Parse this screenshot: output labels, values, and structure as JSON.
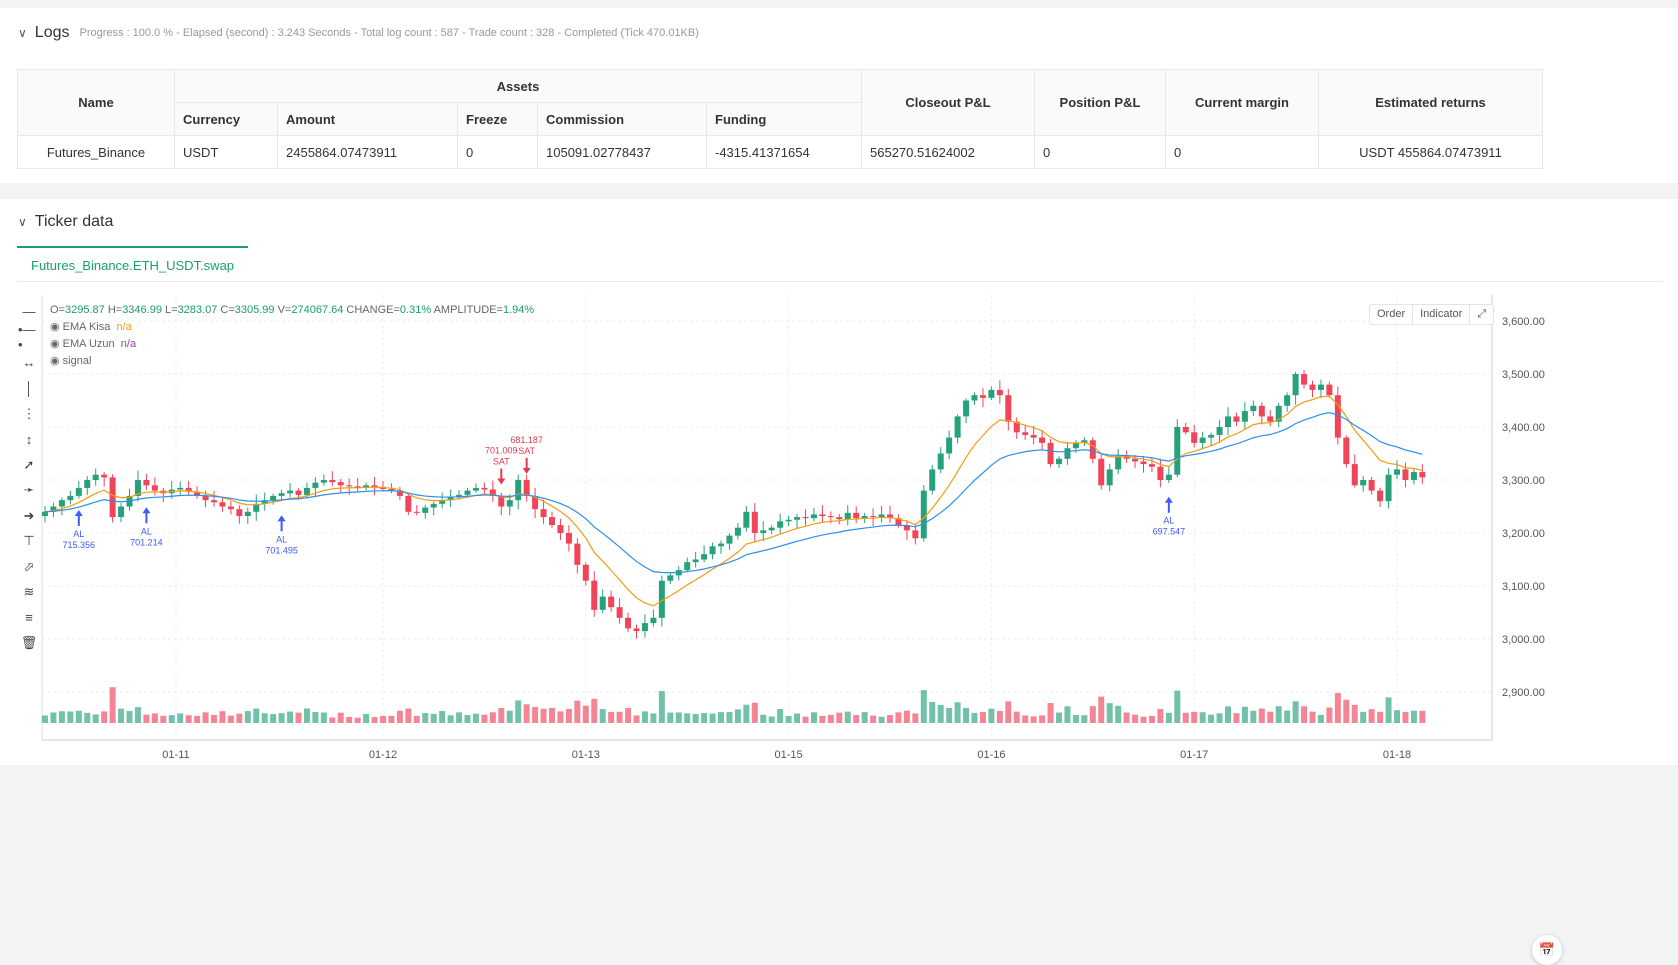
{
  "logs": {
    "title": "Logs",
    "status": "Progress : 100.0 % - Elapsed (second) :  3.243  Seconds - Total log count : 587 - Trade count : 328 - Completed (Tick 470.01KB)",
    "table": {
      "name_header": "Name",
      "assets_header": "Assets",
      "sub_headers": [
        "Currency",
        "Amount",
        "Freeze",
        "Commission",
        "Funding"
      ],
      "other_headers": [
        "Closeout P&L",
        "Position P&L",
        "Current margin",
        "Estimated returns"
      ],
      "row": {
        "name": "Futures_Binance",
        "currency": "USDT",
        "amount": "2455864.07473911",
        "freeze": "0",
        "commission": "105091.02778437",
        "funding": "-4315.41371654",
        "closeout": "565270.51624002",
        "position": "0",
        "margin": "0",
        "returns": "USDT 455864.07473911"
      }
    }
  },
  "ticker": {
    "title": "Ticker data",
    "tab": "Futures_Binance.ETH_USDT.swap",
    "ohlc": {
      "o_label": "O=",
      "o": "3295.87",
      "h_label": "H=",
      "h": "3346.99",
      "l_label": "L=",
      "l": "3283.07",
      "c_label": "C=",
      "c": "3305.99",
      "v_label": "V=",
      "v": "274067.64",
      "chg_label": "CHANGE=",
      "chg": "0.31%",
      "amp_label": "AMPLITUDE=",
      "amp": "1.94%"
    },
    "indicators": [
      {
        "name": "EMA Kisa",
        "value": "n/a",
        "color": "#f39c12"
      },
      {
        "name": "EMA Uzun",
        "value": "n/a",
        "color": "#8e44ad"
      },
      {
        "name": "signal",
        "value": ""
      }
    ],
    "buttons": {
      "order": "Order",
      "indicator": "Indicator"
    }
  },
  "chart_data": {
    "type": "candlestick",
    "y_ticks": [
      "3,600.00",
      "3,500.00",
      "3,400.00",
      "3,300.00",
      "3,200.00",
      "3,100.00",
      "3,000.00",
      "2,900.00"
    ],
    "ylim": [
      2850,
      3650
    ],
    "x_ticks": [
      {
        "label": "01-11",
        "bar": 15.5
      },
      {
        "label": "01-12",
        "bar": 40
      },
      {
        "label": "01-13",
        "bar": 64
      },
      {
        "label": "01-15",
        "bar": 88
      },
      {
        "label": "01-16",
        "bar": 112
      },
      {
        "label": "01-17",
        "bar": 136
      },
      {
        "label": "01-18",
        "bar": 160
      }
    ],
    "colors": {
      "up": "#26a17b",
      "down": "#f0445a",
      "ema_short": "#f39c12",
      "ema_long": "#2e8fe8",
      "buy": "#3d5afe",
      "sell": "#e53950"
    },
    "closes": [
      3240,
      3250,
      3262,
      3270,
      3285,
      3300,
      3310,
      3305,
      3230,
      3250,
      3270,
      3300,
      3290,
      3280,
      3275,
      3282,
      3285,
      3278,
      3270,
      3262,
      3258,
      3250,
      3245,
      3232,
      3240,
      3255,
      3262,
      3270,
      3275,
      3280,
      3272,
      3285,
      3295,
      3300,
      3296,
      3290,
      3288,
      3285,
      3290,
      3287,
      3283,
      3280,
      3270,
      3240,
      3238,
      3248,
      3255,
      3262,
      3268,
      3272,
      3280,
      3285,
      3282,
      3270,
      3250,
      3262,
      3300,
      3270,
      3245,
      3230,
      3215,
      3200,
      3180,
      3140,
      3110,
      3055,
      3080,
      3060,
      3040,
      3020,
      3015,
      3030,
      3040,
      3110,
      3120,
      3130,
      3145,
      3150,
      3160,
      3175,
      3180,
      3195,
      3210,
      3240,
      3200,
      3205,
      3210,
      3222,
      3225,
      3230,
      3228,
      3235,
      3232,
      3230,
      3226,
      3238,
      3228,
      3232,
      3230,
      3235,
      3228,
      3215,
      3205,
      3190,
      3280,
      3320,
      3350,
      3380,
      3420,
      3450,
      3460,
      3455,
      3470,
      3460,
      3410,
      3390,
      3385,
      3380,
      3370,
      3330,
      3340,
      3360,
      3370,
      3375,
      3340,
      3290,
      3320,
      3345,
      3340,
      3335,
      3330,
      3325,
      3300,
      3310,
      3400,
      3390,
      3370,
      3380,
      3385,
      3400,
      3420,
      3410,
      3430,
      3440,
      3420,
      3410,
      3440,
      3460,
      3500,
      3480,
      3470,
      3480,
      3460,
      3380,
      3330,
      3290,
      3300,
      3280,
      3260,
      3310,
      3320,
      3300,
      3315,
      3305
    ],
    "signals": [
      {
        "type": "AL",
        "value": "715.356",
        "bar": 4
      },
      {
        "type": "AL",
        "value": "701.214",
        "bar": 12
      },
      {
        "type": "AL",
        "value": "701.495",
        "bar": 28
      },
      {
        "type": "SAT",
        "value": "701.009",
        "bar": 54
      },
      {
        "type": "SAT",
        "value": "681.187",
        "bar": 57
      },
      {
        "type": "AL",
        "value": "697.547",
        "bar": 133
      }
    ]
  }
}
